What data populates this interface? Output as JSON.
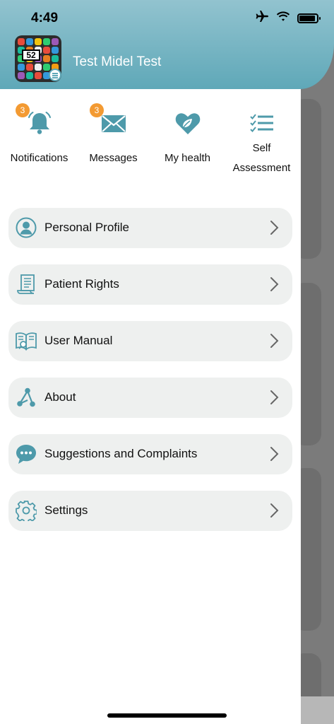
{
  "status_bar": {
    "time": "4:49",
    "icons": [
      "airplane-icon",
      "wifi-icon",
      "battery-icon"
    ]
  },
  "header": {
    "user_name": "Test Midel Test",
    "avatar_number": "52",
    "accent_color": "#5fa8b8"
  },
  "quick_actions": [
    {
      "label": "Notifications",
      "icon": "bell-icon",
      "badge": "3"
    },
    {
      "label": "Messages",
      "icon": "envelope-icon",
      "badge": "3"
    },
    {
      "label": "My health",
      "icon": "heart-leaf-icon",
      "badge": ""
    },
    {
      "label": "Self Assessment",
      "label_line1": "Self",
      "label_line2": "Assessment",
      "icon": "checklist-icon",
      "badge": ""
    }
  ],
  "menu": [
    {
      "label": "Personal Profile",
      "icon": "user-icon"
    },
    {
      "label": "Patient Rights",
      "icon": "scroll-icon"
    },
    {
      "label": "User Manual",
      "icon": "book-icon"
    },
    {
      "label": "About",
      "icon": "nodes-icon"
    },
    {
      "label": "Suggestions and Complaints",
      "icon": "chat-bubble-icon"
    },
    {
      "label": "Settings",
      "icon": "gear-icon"
    }
  ],
  "colors": {
    "header_gradient_top": "#92c3cf",
    "header_gradient_bottom": "#5fa8b8",
    "icon_color": "#4e9aaa",
    "badge_color": "#f39a32",
    "menu_item_bg": "#eef0ef"
  }
}
